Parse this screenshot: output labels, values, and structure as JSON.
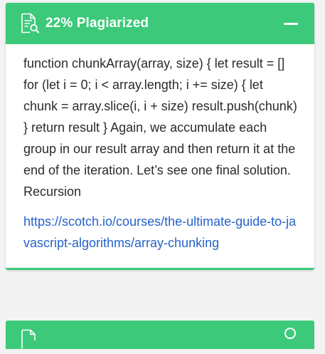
{
  "result_card": {
    "header": {
      "title": "22% Plagiarized",
      "icon": "document-search-icon",
      "action_icon": "minus-icon"
    },
    "body": {
      "text": "function chunkArray(array, size) { let result = [] for (let i = 0; i < array.length; i += size) { let chunk = array.slice(i, i + size) result.push(chunk) } return result } Again, we accumulate each group in our result array and then return it at the end of the iteration. Let’s see one final solution. Recursion",
      "source_url": "https://scotch.io/courses/the-ultimate-guide-to-javascript-algorithms/array-chunking"
    }
  },
  "next_card": {
    "icon": "document-search-icon"
  },
  "colors": {
    "accent": "#3cc97a",
    "link": "#2563c9",
    "text": "#2b2b2b"
  }
}
